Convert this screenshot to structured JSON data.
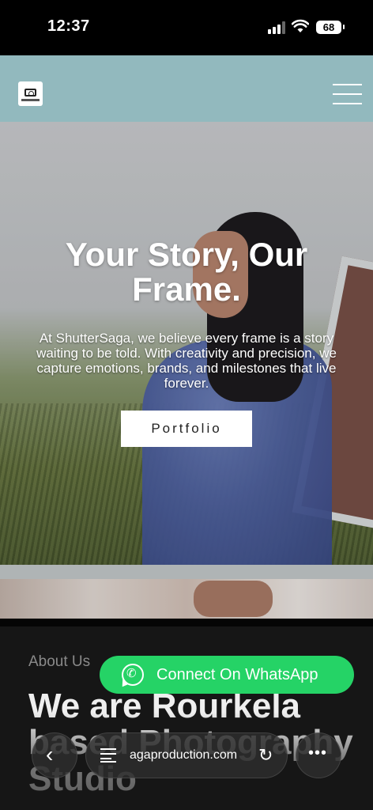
{
  "status_bar": {
    "time": "12:37",
    "battery": "68"
  },
  "nav": {
    "logo": "logo-camera-icon",
    "menu_icon": "hamburger-menu-icon"
  },
  "hero": {
    "title": "Your Story, Our Frame.",
    "subtitle": "At ShutterSaga, we believe every frame is a story waiting to be told. With creativity and precision, we capture emotions, brands, and milestones that live forever.",
    "button_label": "Portfolio"
  },
  "about": {
    "label": "About Us",
    "title": "We are Rourkela based Photography Studio"
  },
  "whatsapp": {
    "label": "Connect On WhatsApp",
    "color": "#25d366"
  },
  "browser": {
    "url": "agaproduction.com",
    "back_icon": "chevron-left-icon",
    "tabs_icon": "tabs-icon",
    "reload_icon": "reload-icon",
    "more_icon": "more-icon"
  }
}
